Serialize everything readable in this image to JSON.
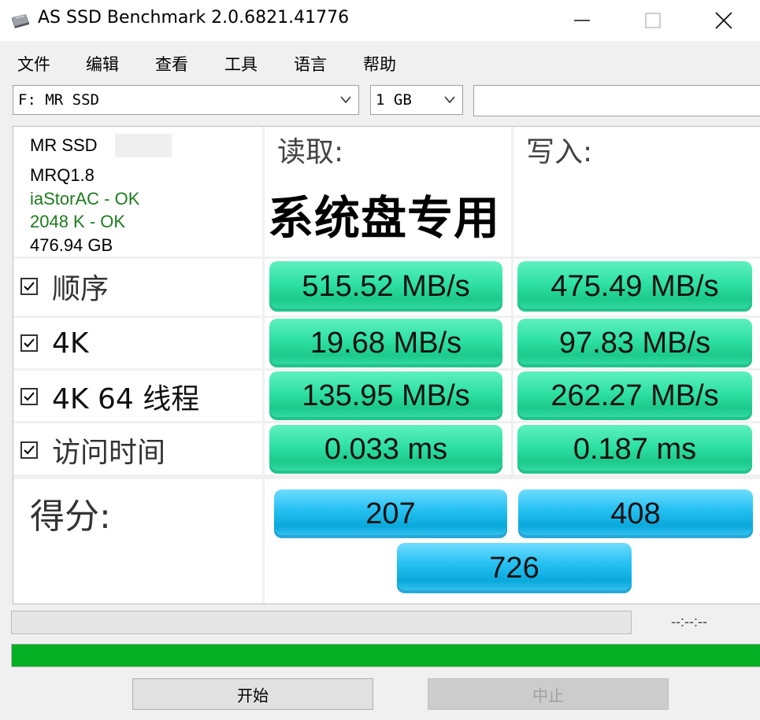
{
  "window": {
    "title": "AS SSD Benchmark 2.0.6821.41776",
    "icon": "ssd-drive-icon"
  },
  "menu": [
    "文件",
    "编辑",
    "查看",
    "工具",
    "语言",
    "帮助"
  ],
  "drive_select": {
    "value": "F: MR SSD"
  },
  "size_select": {
    "value": "1 GB"
  },
  "text_box": {
    "value": ""
  },
  "info": {
    "model": "MR SSD",
    "firmware": "MRQ1.8",
    "driver": "iaStorAC - OK",
    "alignment": "2048 K - OK",
    "capacity": "476.94 GB",
    "ok_color": "#1f7a1f"
  },
  "headers": {
    "read": "读取:",
    "write": "写入:",
    "overlay": "系统盘专用"
  },
  "rows": [
    {
      "label": "顺序",
      "checked": true,
      "read": "515.52 MB/s",
      "write": "475.49 MB/s"
    },
    {
      "label": "4K",
      "checked": true,
      "read": "19.68 MB/s",
      "write": "97.83 MB/s"
    },
    {
      "label": "4K 64 线程",
      "checked": true,
      "read": "135.95 MB/s",
      "write": "262.27 MB/s"
    },
    {
      "label": "访问时间",
      "checked": true,
      "read": "0.033 ms",
      "write": "0.187 ms"
    }
  ],
  "score": {
    "label": "得分:",
    "read": "207",
    "write": "408",
    "total": "726"
  },
  "progress": {
    "time": "--:--:--",
    "total_fraction": 1.0,
    "bar_color": "#06b025"
  },
  "buttons": {
    "start": "开始",
    "abort": "中止"
  },
  "colors": {
    "result_green": "#2ee0a3",
    "result_blue": "#27c2f2"
  }
}
